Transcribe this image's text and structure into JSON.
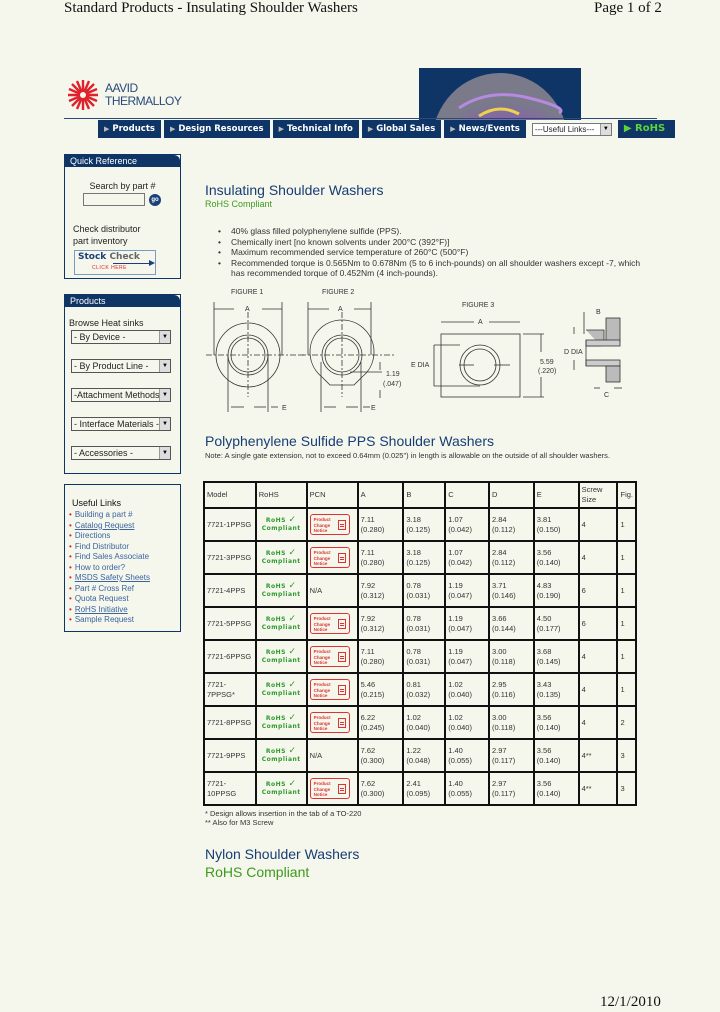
{
  "print_header": {
    "title": "Standard Products - Insulating Shoulder Washers",
    "page": "Page 1 of 2"
  },
  "print_footer": {
    "date": "12/1/2010"
  },
  "logo": {
    "line1": "AAVID",
    "line2": "THERMALLOY",
    "icon": "starburst-logo-icon"
  },
  "nav": {
    "items": [
      {
        "label": "Products"
      },
      {
        "label": "Design Resources"
      },
      {
        "label": "Technical Info"
      },
      {
        "label": "Global Sales"
      },
      {
        "label": "News/Events"
      }
    ],
    "useful_links_select": "---Useful Links---",
    "rohs_label": "RoHS",
    "colors": {
      "nav_bg": "#0f3566",
      "rohs_green": "#5cd33c"
    }
  },
  "quick_reference": {
    "title": "Quick Reference",
    "search_label": "Search by part #",
    "search_value": "",
    "go_label": "go",
    "check_text_1": "Check distributor",
    "check_text_2": "part inventory",
    "stock_check_1": "Stock",
    "stock_check_2": "Check",
    "stock_click": "CLICK HERE"
  },
  "products_panel": {
    "title": "Products",
    "browse_label": "Browse Heat sinks",
    "selects": [
      "- By Device -",
      "- By Product Line -",
      "-Attachment Methods",
      "- Interface Materials -",
      "- Accessories -"
    ]
  },
  "useful_links": {
    "title": "Useful Links",
    "items": [
      {
        "label": "Building a part #",
        "underline": false
      },
      {
        "label": "Catalog Request",
        "underline": true
      },
      {
        "label": "Directions",
        "underline": false
      },
      {
        "label": "Find Distributor",
        "underline": false
      },
      {
        "label": "Find Sales Associate",
        "underline": false
      },
      {
        "label": "How to order?",
        "underline": false
      },
      {
        "label": "MSDS Safety Sheets",
        "underline": true
      },
      {
        "label": "Part # Cross Ref",
        "underline": false
      },
      {
        "label": "Quota Request",
        "underline": false
      },
      {
        "label": "RoHS Initiative",
        "underline": true
      },
      {
        "label": "Sample Request",
        "underline": false
      }
    ]
  },
  "main": {
    "title": "Insulating Shoulder Washers",
    "rohs": "RoHS Compliant",
    "bullets": [
      "40% glass filled polyphenylene sulfide (PPS).",
      "Chemically inert [no known solvents under 200°C (392°F)]",
      "Maximum recommended service temperature of 260°C (500°F)",
      "Recommended torque is 0.565Nm to 0.678Nm (5 to 6 inch-pounds) on all shoulder washers except -7, which has recommended torque of 0.452Nm (4 inch-pounds)."
    ],
    "figures": {
      "fig1": "FIGURE 1",
      "fig2": "FIGURE 2",
      "fig3": "FIGURE 3",
      "dim_a": "A",
      "dim_b": "B",
      "dim_c": "C",
      "dim_e": "E",
      "dim_d_dia": "D DIA",
      "dim_e_dia": "E DIA",
      "dim_119": "1.19",
      "dim_119_in": "(.047)",
      "dim_559": "5.59",
      "dim_559_in": "(.220)"
    },
    "pps_title": "Polyphenylene Sulfide PPS Shoulder Washers",
    "pps_note": "Note: A single gate extension, not to exceed 0.64mm (0.025\") in length is allowable on the outside of all shoulder washers.",
    "table": {
      "headers": [
        "Model",
        "RoHS",
        "PCN",
        "A",
        "B",
        "C",
        "D",
        "E",
        "Screw Size",
        "Fig."
      ],
      "rohs_badge": {
        "line1": "RoHS",
        "line2": "Compliant"
      },
      "pcn_badge": {
        "line1": "Product",
        "line2": "Change",
        "line3": "Notice"
      },
      "rows": [
        {
          "model": "7721-1PPSG",
          "pcn": true,
          "a": [
            "7.11",
            "(0.280)"
          ],
          "b": [
            "3.18",
            "(0.125)"
          ],
          "c": [
            "1.07",
            "(0.042)"
          ],
          "d": [
            "2.84",
            "(0.112)"
          ],
          "e": [
            "3.81",
            "(0.150)"
          ],
          "screw": "4",
          "fig": "1"
        },
        {
          "model": "7721-3PPSG",
          "pcn": true,
          "a": [
            "7.11",
            "(0.280)"
          ],
          "b": [
            "3.18",
            "(0.125)"
          ],
          "c": [
            "1.07",
            "(0.042)"
          ],
          "d": [
            "2.84",
            "(0.112)"
          ],
          "e": [
            "3.56",
            "(0.140)"
          ],
          "screw": "4",
          "fig": "1"
        },
        {
          "model": "7721-4PPS",
          "pcn": false,
          "a": [
            "7.92",
            "(0.312)"
          ],
          "b": [
            "0.78",
            "(0.031)"
          ],
          "c": [
            "1.19",
            "(0.047)"
          ],
          "d": [
            "3.71",
            "(0.146)"
          ],
          "e": [
            "4.83",
            "(0.190)"
          ],
          "screw": "6",
          "fig": "1"
        },
        {
          "model": "7721-5PPSG",
          "pcn": true,
          "a": [
            "7.92",
            "(0.312)"
          ],
          "b": [
            "0.78",
            "(0.031)"
          ],
          "c": [
            "1.19",
            "(0.047)"
          ],
          "d": [
            "3.66",
            "(0.144)"
          ],
          "e": [
            "4.50",
            "(0.177)"
          ],
          "screw": "6",
          "fig": "1"
        },
        {
          "model": "7721-6PPSG",
          "pcn": true,
          "a": [
            "7.11",
            "(0.280)"
          ],
          "b": [
            "0.78",
            "(0.031)"
          ],
          "c": [
            "1.19",
            "(0.047)"
          ],
          "d": [
            "3.00",
            "(0.118)"
          ],
          "e": [
            "3.68",
            "(0.145)"
          ],
          "screw": "4",
          "fig": "1"
        },
        {
          "model": "7721-7PPSG*",
          "pcn": true,
          "a": [
            "5.46",
            "(0.215)"
          ],
          "b": [
            "0.81",
            "(0.032)"
          ],
          "c": [
            "1.02",
            "(0.040)"
          ],
          "d": [
            "2.95",
            "(0.116)"
          ],
          "e": [
            "3.43",
            "(0.135)"
          ],
          "screw": "4",
          "fig": "1"
        },
        {
          "model": "7721-8PPSG",
          "pcn": true,
          "a": [
            "6.22",
            "(0.245)"
          ],
          "b": [
            "1.02",
            "(0.040)"
          ],
          "c": [
            "1.02",
            "(0.040)"
          ],
          "d": [
            "3.00",
            "(0.118)"
          ],
          "e": [
            "3.56",
            "(0.140)"
          ],
          "screw": "4",
          "fig": "2"
        },
        {
          "model": "7721-9PPS",
          "pcn": false,
          "a": [
            "7.62",
            "(0.300)"
          ],
          "b": [
            "1.22",
            "(0.048)"
          ],
          "c": [
            "1.40",
            "(0.055)"
          ],
          "d": [
            "2.97",
            "(0.117)"
          ],
          "e": [
            "3.56",
            "(0.140)"
          ],
          "screw": "4**",
          "fig": "3"
        },
        {
          "model": "7721-10PPSG",
          "pcn": true,
          "a": [
            "7.62",
            "(0.300)"
          ],
          "b": [
            "2.41",
            "(0.095)"
          ],
          "c": [
            "1.40",
            "(0.055)"
          ],
          "d": [
            "2.97",
            "(0.117)"
          ],
          "e": [
            "3.56",
            "(0.140)"
          ],
          "screw": "4**",
          "fig": "3"
        }
      ],
      "na_label": "N/A"
    },
    "footnote_1": "* Design allows insertion in the tab of a TO-220",
    "footnote_2": "** Also for M3 Screw",
    "nylon_title": "Nylon Shoulder Washers",
    "nylon_rohs": "RoHS Compliant"
  }
}
